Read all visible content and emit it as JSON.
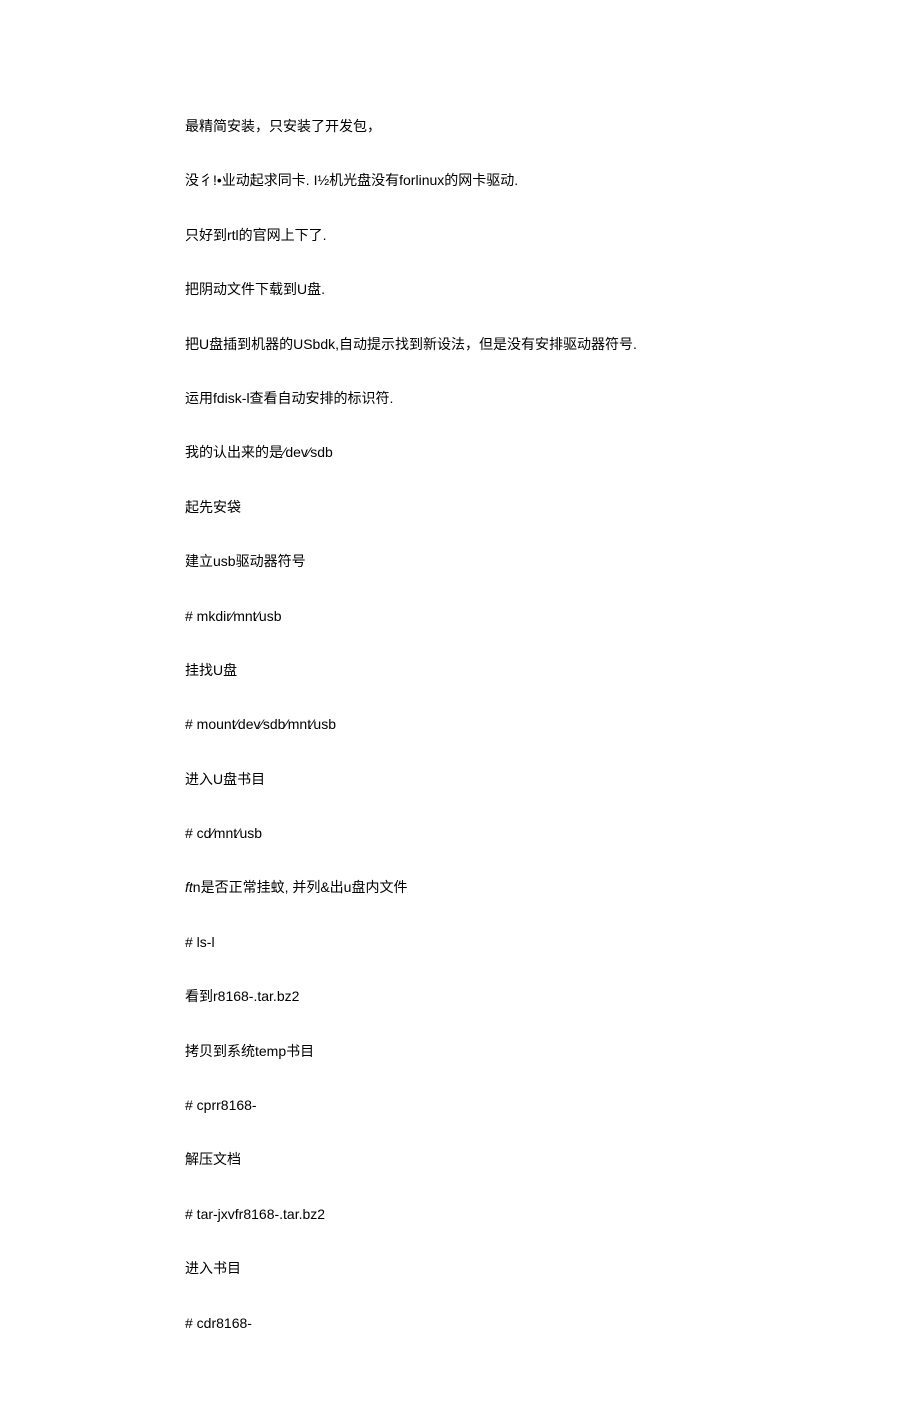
{
  "lines": {
    "l1": "最精简安装，只安装了开发包，",
    "l2": "没彳!•业动起求同卡. I½机光盘没有forlinux的网卡驱动.",
    "l3": "只好到rtl的官网上下了.",
    "l4": "把阴动文件下载到U盘.",
    "l5": "把U盘插到机器的USbdk,自动提示找到新设法，但是没有安排驱动器符号.",
    "l6": "运用fdisk-l查看自动安排的标识符.",
    "l7": "我的认出来的是⁄dev⁄sdb",
    "l8": "起先安袋",
    "l9": "建立usb驱动器符号",
    "l10": "#   mkdir⁄mnt⁄usb",
    "l11": "挂找U盘",
    "l12": "#   mount⁄dev⁄sdb⁄mnt⁄usb",
    "l13": "进入U盘书目",
    "l14": "#   cd⁄mnt⁄usb",
    "l15_prefix": "ft",
    "l15_rest": "n是否正常挂蚊, 并列&出u盘内文件",
    "l16": "#   ls-l",
    "l17": "看到r8168-.tar.bz2",
    "l18": "拷贝到系统temp书目",
    "l19": "#   cprr8168-",
    "l20": "解压文档",
    "l21": "#   tar-jxvfr8168-.tar.bz2",
    "l22": "进入书目",
    "l23": "#   cdr8168-"
  }
}
